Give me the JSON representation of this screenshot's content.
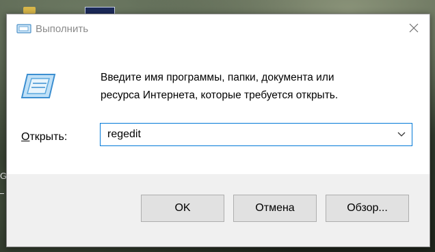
{
  "window": {
    "title": "Выполнить",
    "close_icon": "close-icon",
    "app_icon": "run-icon"
  },
  "content": {
    "description_line1": "Введите имя программы, папки, документа или",
    "description_line2": "ресурса Интернета, которые требуется открыть.",
    "open_label_prefix": "О",
    "open_label_rest": "ткрыть:",
    "input_value": "regedit",
    "dropdown_icon": "chevron-down-icon"
  },
  "buttons": {
    "ok": "OK",
    "cancel": "Отмена",
    "browse": "Обзор..."
  },
  "desktop": {
    "left_edge_text": "G"
  },
  "colors": {
    "accent": "#0078d7",
    "button_bg": "#e1e1e1",
    "footer_bg": "#f0f0f0"
  }
}
